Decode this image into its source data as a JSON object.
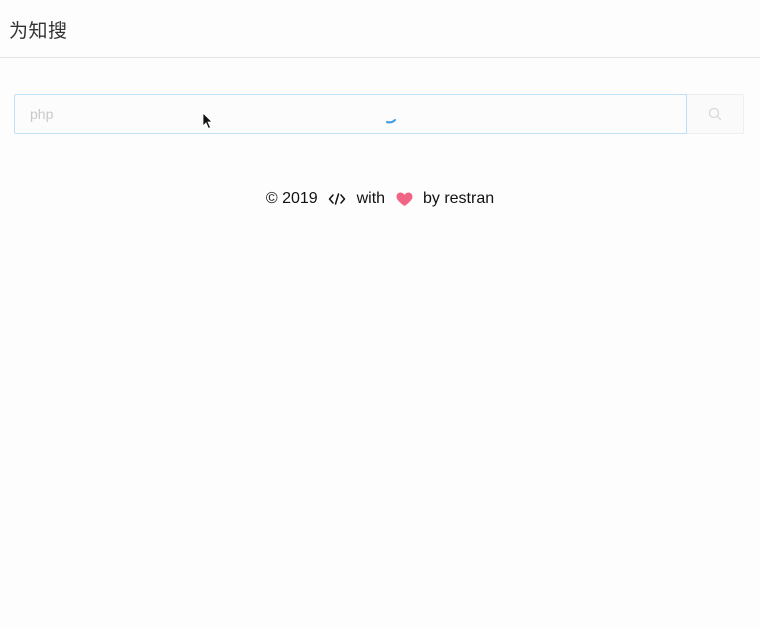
{
  "header": {
    "brand": "为知搜"
  },
  "search": {
    "placeholder": "php",
    "value": "",
    "button_icon": "search-icon",
    "loading_icon": "loading-spinner-icon"
  },
  "footer": {
    "copyright": "© 2019",
    "code_icon": "code-icon",
    "with_text": "with",
    "heart_icon": "heart-icon",
    "by_text": "by restran"
  },
  "colors": {
    "accent": "#3a9be6",
    "input_border": "#bfe0f7",
    "heart": "#f06584",
    "divider": "#e4e4e4"
  }
}
